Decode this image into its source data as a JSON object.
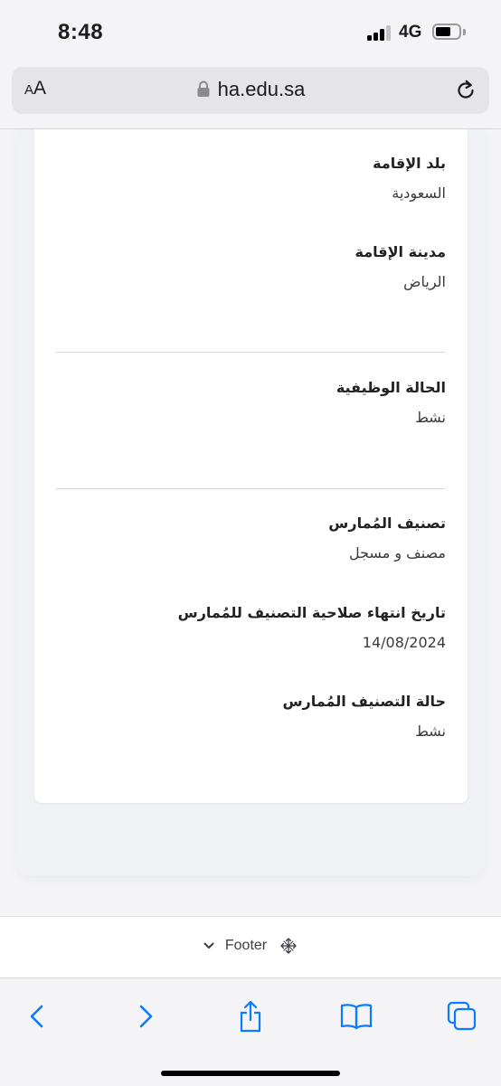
{
  "status_bar": {
    "time": "8:48",
    "network": "4G",
    "signal_bars_active": 3,
    "signal_bars_total": 4,
    "battery_level": 0.65
  },
  "browser": {
    "text_size_small": "A",
    "text_size_big": "A",
    "url": "ha.edu.sa",
    "lock_icon": "lock-icon",
    "reload_icon": "reload-icon"
  },
  "profile": {
    "residence_country": {
      "label": "بلد الإقامة",
      "value": "السعودية"
    },
    "residence_city": {
      "label": "مدينة الإقامة",
      "value": "الرياض"
    },
    "employment_status": {
      "label": "الحالة الوظيفية",
      "value": "نشط"
    },
    "practitioner_classification": {
      "label": "تصنيف المُمارس",
      "value": "مصنف و مسجل"
    },
    "classification_expiry": {
      "label": "تاريخ انتهاء صلاحية التصنيف للمُمارس",
      "value": "14/08/2024"
    },
    "classification_status": {
      "label": "حالة التصنيف المُمارس",
      "value": "نشط"
    }
  },
  "footer": {
    "label": "Footer",
    "chevron_icon": "chevron-down-icon",
    "move_icon": "move-arrows-icon"
  },
  "toolbar": {
    "icons": [
      "back-icon",
      "forward-icon",
      "share-icon",
      "bookmarks-icon",
      "tabs-icon"
    ],
    "accent_color": "#0a7aff"
  }
}
